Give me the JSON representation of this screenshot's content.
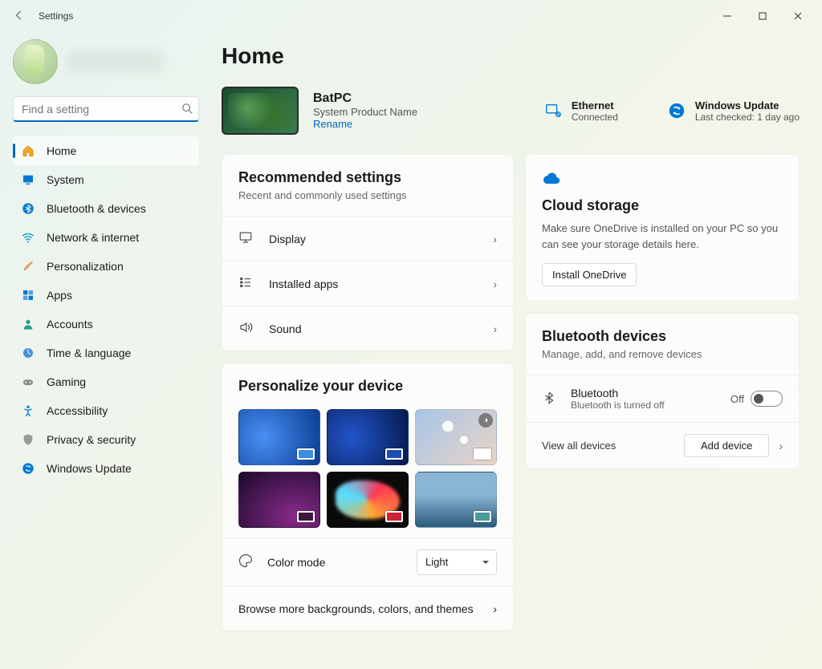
{
  "window": {
    "title": "Settings"
  },
  "search": {
    "placeholder": "Find a setting"
  },
  "nav": {
    "items": [
      {
        "id": "home",
        "label": "Home"
      },
      {
        "id": "system",
        "label": "System"
      },
      {
        "id": "bluetooth",
        "label": "Bluetooth & devices"
      },
      {
        "id": "network",
        "label": "Network & internet"
      },
      {
        "id": "personalization",
        "label": "Personalization"
      },
      {
        "id": "apps",
        "label": "Apps"
      },
      {
        "id": "accounts",
        "label": "Accounts"
      },
      {
        "id": "time",
        "label": "Time & language"
      },
      {
        "id": "gaming",
        "label": "Gaming"
      },
      {
        "id": "accessibility",
        "label": "Accessibility"
      },
      {
        "id": "privacy",
        "label": "Privacy & security"
      },
      {
        "id": "update",
        "label": "Windows Update"
      }
    ],
    "active": "home"
  },
  "page": {
    "title": "Home"
  },
  "device": {
    "name": "BatPC",
    "product": "System Product Name",
    "rename": "Rename"
  },
  "status": {
    "ethernet": {
      "title": "Ethernet",
      "sub": "Connected"
    },
    "update": {
      "title": "Windows Update",
      "sub": "Last checked: 1 day ago"
    }
  },
  "recommended": {
    "title": "Recommended settings",
    "sub": "Recent and commonly used settings",
    "items": [
      {
        "id": "display",
        "label": "Display"
      },
      {
        "id": "installed",
        "label": "Installed apps"
      },
      {
        "id": "sound",
        "label": "Sound"
      }
    ]
  },
  "personalize": {
    "title": "Personalize your device",
    "colormode_label": "Color mode",
    "colormode_value": "Light",
    "browse": "Browse more backgrounds, colors, and themes"
  },
  "cloud": {
    "title": "Cloud storage",
    "desc": "Make sure OneDrive is installed on your PC so you can see your storage details here.",
    "button": "Install OneDrive"
  },
  "bluetooth": {
    "title": "Bluetooth devices",
    "sub": "Manage, add, and remove devices",
    "row_title": "Bluetooth",
    "row_sub": "Bluetooth is turned off",
    "state": "Off",
    "view_all": "View all devices",
    "add": "Add device"
  }
}
